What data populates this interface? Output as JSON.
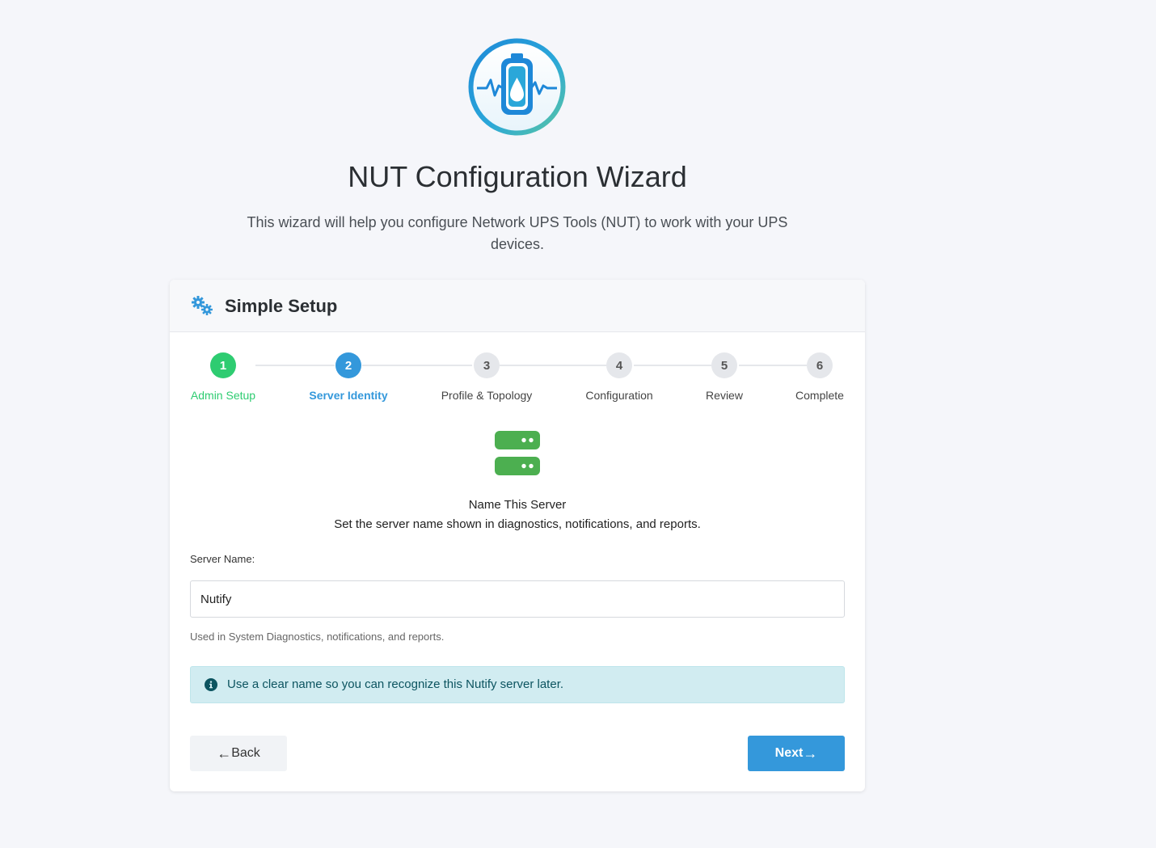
{
  "header": {
    "title": "NUT Configuration Wizard",
    "intro": "This wizard will help you configure Network UPS Tools (NUT) to work with your UPS devices."
  },
  "card": {
    "title": "Simple Setup"
  },
  "steps": [
    {
      "number": "1",
      "label": "Admin Setup",
      "state": "done"
    },
    {
      "number": "2",
      "label": "Server Identity",
      "state": "active"
    },
    {
      "number": "3",
      "label": "Profile & Topology",
      "state": "pending"
    },
    {
      "number": "4",
      "label": "Configuration",
      "state": "pending"
    },
    {
      "number": "5",
      "label": "Review",
      "state": "pending"
    },
    {
      "number": "6",
      "label": "Complete",
      "state": "pending"
    }
  ],
  "section": {
    "title": "Name This Server",
    "description": "Set the server name shown in diagnostics, notifications, and reports."
  },
  "form": {
    "server_name_label": "Server Name:",
    "server_name_value": "Nutify",
    "server_name_help": "Used in System Diagnostics, notifications, and reports."
  },
  "alert": {
    "text": "Use a clear name so you can recognize this Nutify server later.",
    "icon": "info-icon"
  },
  "buttons": {
    "back_label": "Back",
    "next_label": "Next"
  },
  "colors": {
    "accent": "#3498db",
    "success": "#2ecc71",
    "server_icon": "#4caf50",
    "alert_bg": "#d1ecf1",
    "alert_text": "#0c5460"
  }
}
